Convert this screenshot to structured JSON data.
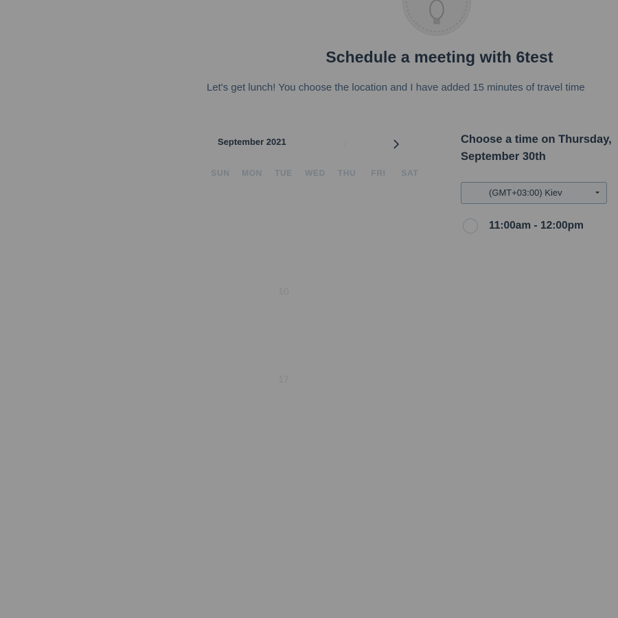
{
  "header": {
    "title": "Schedule a meeting with 6test",
    "subtitle": "Let's get lunch! You choose the location and I have added 15 minutes of travel time"
  },
  "avatar": {
    "icon": "user-avatar-icon"
  },
  "calendar": {
    "month_label": "September 2021",
    "prev_icon": "chevron-left-icon",
    "next_icon": "chevron-right-icon",
    "weekdays": [
      "SUN",
      "MON",
      "TUE",
      "WED",
      "THU",
      "FRI",
      "SAT"
    ],
    "visible_days": [
      "10",
      "17"
    ]
  },
  "times": {
    "heading": "Choose a time on Thursday, September 30th",
    "timezone_label": "(GMT+03:00) Kiev",
    "slots": [
      {
        "label": "11:00am - 12:00pm"
      }
    ]
  },
  "colors": {
    "overlay": "rgba(0,0,0,0.41)",
    "text_primary": "#33475b",
    "text_secondary": "#516f90"
  }
}
